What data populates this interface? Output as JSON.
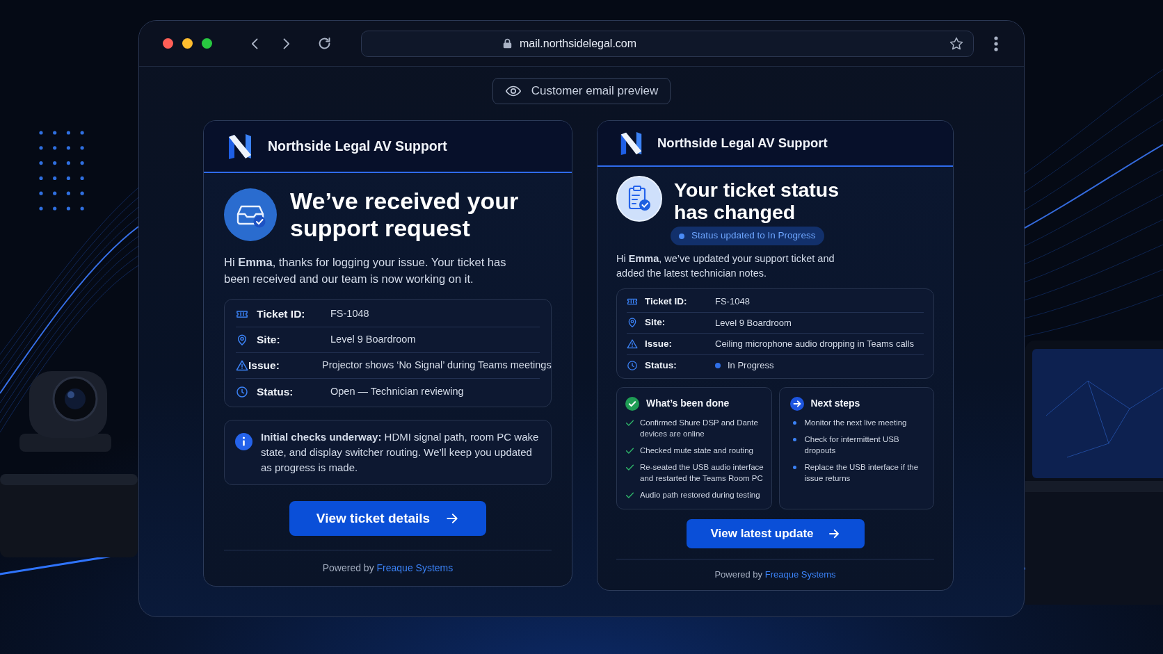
{
  "browser": {
    "url": "mail.northsidelegal.com"
  },
  "preview_label": "Customer email preview",
  "emails": [
    {
      "kind": "received",
      "brand": "Northside Legal AV Support",
      "heading": "We’ve received your support request",
      "intro": "Hi **Emma**, thanks for logging your issue. Your ticket has been received and our team is now working on it.",
      "details": [
        {
          "kind": "ticket",
          "label": "Ticket ID:",
          "value": "FS-1048"
        },
        {
          "kind": "site",
          "label": "Site:",
          "value": "Level 9 Boardroom"
        },
        {
          "kind": "issue",
          "label": "Issue:",
          "value": "Projector shows ‘No Signal’ during Teams meetings"
        },
        {
          "kind": "status",
          "label": "Status:",
          "value": "Open — Technician reviewing"
        }
      ],
      "notice": "**Initial checks underway:** HDMI signal path, room PC wake state, and display switcher routing. We’ll keep you updated as progress is made.",
      "button": "View ticket details",
      "footer": {
        "text": "Powered by",
        "link": "Freaque Systems"
      }
    },
    {
      "kind": "status_change",
      "brand": "Northside Legal AV Support",
      "heading": "Your ticket status has changed",
      "badge": "Status updated to In Progress",
      "intro": "Hi **Emma**, we’ve updated your support ticket and added the latest technician notes.",
      "details": [
        {
          "kind": "ticket",
          "label": "Ticket ID:",
          "value": "FS-1048"
        },
        {
          "kind": "site",
          "label": "Site:",
          "value": "Level 9 Boardroom"
        },
        {
          "kind": "issue",
          "label": "Issue:",
          "value": "Ceiling microphone audio dropping in Teams calls"
        },
        {
          "kind": "status",
          "label": "Status:",
          "value": "In Progress",
          "color": "#2f6fe8"
        }
      ],
      "panels": [
        {
          "kind": "done",
          "title": "What’s been done",
          "items": [
            "Confirmed Shure DSP and Dante devices are online",
            "Checked mute state and routing",
            "Re-seated the USB audio interface and restarted the Teams Room PC",
            "Audio path restored during testing"
          ]
        },
        {
          "kind": "next",
          "title": "Next steps",
          "items": [
            "Monitor the next live meeting",
            "Check for intermittent USB dropouts",
            "Replace the USB interface if the issue returns"
          ]
        }
      ],
      "button": "View latest update",
      "footer": {
        "text": "Powered by",
        "link": "Freaque Systems"
      }
    }
  ]
}
